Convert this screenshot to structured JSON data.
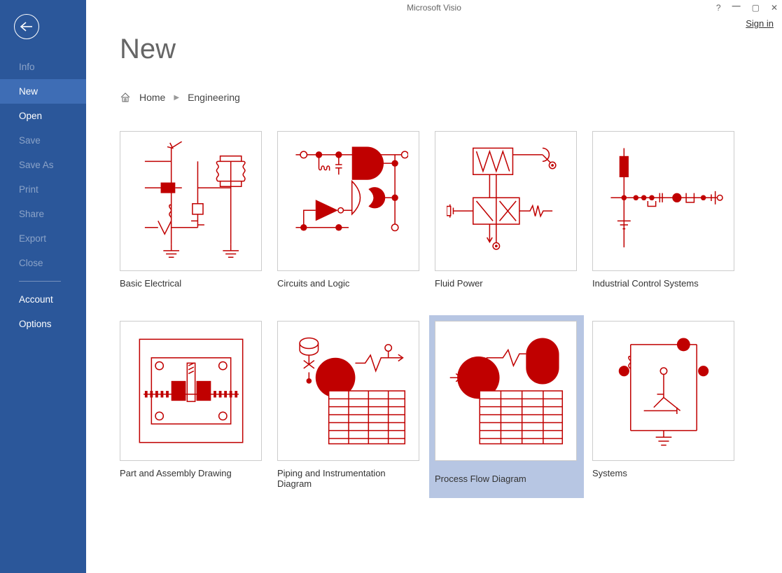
{
  "app": {
    "title": "Microsoft Visio",
    "signin": "Sign in"
  },
  "sidebar": {
    "items": [
      {
        "label": "Info",
        "disabled": true,
        "selected": false
      },
      {
        "label": "New",
        "disabled": false,
        "selected": true
      },
      {
        "label": "Open",
        "disabled": false,
        "selected": false
      },
      {
        "label": "Save",
        "disabled": true,
        "selected": false
      },
      {
        "label": "Save As",
        "disabled": true,
        "selected": false
      },
      {
        "label": "Print",
        "disabled": true,
        "selected": false
      },
      {
        "label": "Share",
        "disabled": true,
        "selected": false
      },
      {
        "label": "Export",
        "disabled": true,
        "selected": false
      },
      {
        "label": "Close",
        "disabled": true,
        "selected": false
      }
    ],
    "bottom": [
      {
        "label": "Account"
      },
      {
        "label": "Options"
      }
    ]
  },
  "page": {
    "title": "New",
    "crumbs": [
      "Home",
      "Engineering"
    ]
  },
  "templates": [
    {
      "label": "Basic Electrical",
      "icon": "basic-electrical",
      "selected": false
    },
    {
      "label": "Circuits and Logic",
      "icon": "circuits-logic",
      "selected": false
    },
    {
      "label": "Fluid Power",
      "icon": "fluid-power",
      "selected": false
    },
    {
      "label": "Industrial Control Systems",
      "icon": "industrial-control",
      "selected": false
    },
    {
      "label": "Part and Assembly Drawing",
      "icon": "part-assembly",
      "selected": false
    },
    {
      "label": "Piping and Instrumentation Diagram",
      "icon": "piping-instr",
      "selected": false
    },
    {
      "label": "Process Flow Diagram",
      "icon": "process-flow",
      "selected": true
    },
    {
      "label": "Systems",
      "icon": "systems",
      "selected": false
    }
  ]
}
